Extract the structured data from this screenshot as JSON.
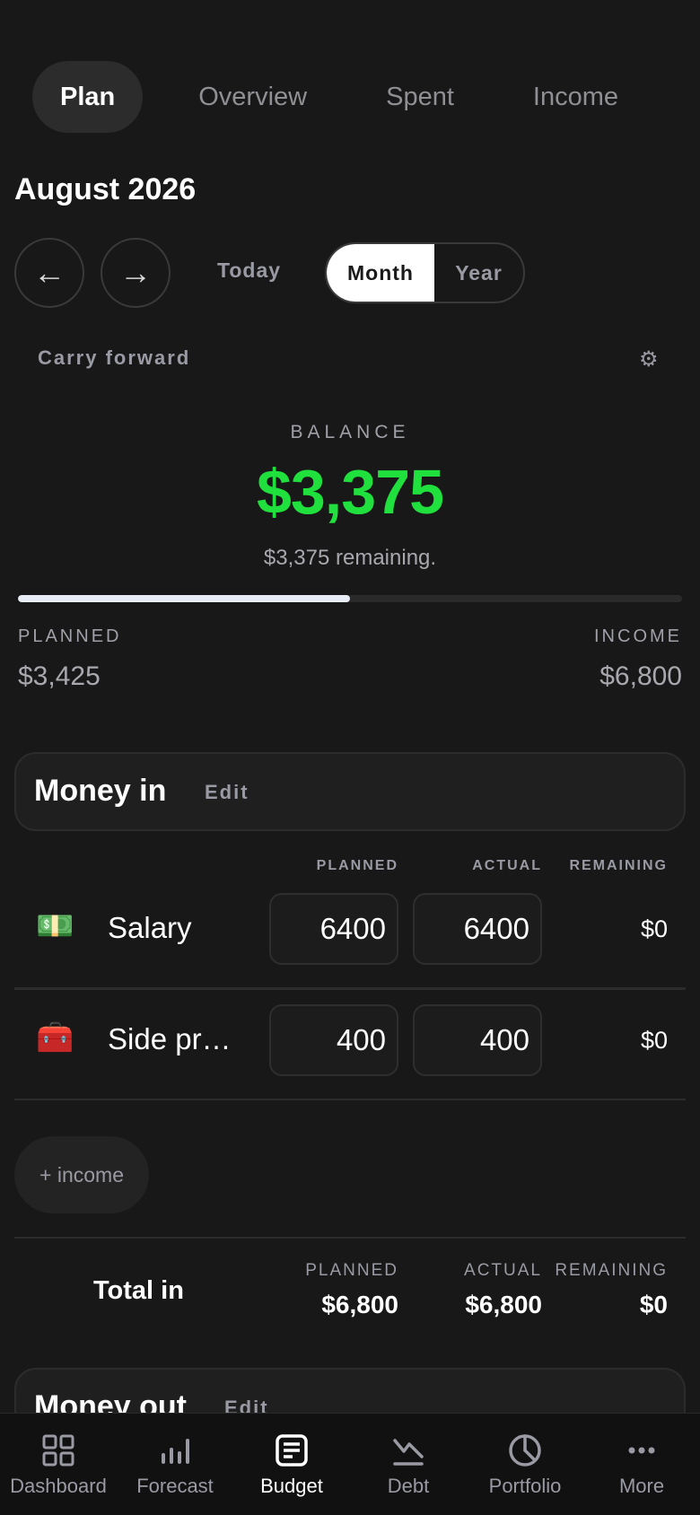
{
  "tabs": [
    "Plan",
    "Overview",
    "Spent",
    "Income"
  ],
  "period": {
    "title": "August 2026",
    "prev_icon": "←",
    "next_icon": "→",
    "today_label": "Today",
    "month_label": "Month",
    "year_label": "Year"
  },
  "carry_forward": {
    "label": "Carry forward",
    "settings_icon": "⚙"
  },
  "balance": {
    "label": "BALANCE",
    "value": "$3,375",
    "remaining_text": "$3,375 remaining.",
    "progress_fraction": 0.5,
    "planned_label": "PLANNED",
    "planned_value": "$3,425",
    "income_label": "INCOME",
    "income_value": "$6,800",
    "accent_color": "#1fe03c"
  },
  "money_in": {
    "title": "Money in",
    "edit_label": "Edit",
    "headers": {
      "planned": "PLANNED",
      "actual": "ACTUAL",
      "remaining": "REMAINING"
    },
    "rows": [
      {
        "icon": "💵",
        "icon_name": "cash-icon",
        "name": "Salary",
        "planned": "6400",
        "actual": "6400",
        "remaining": "$0"
      },
      {
        "icon": "🧰",
        "icon_name": "toolbox-icon",
        "name": "Side pr…",
        "planned": "400",
        "actual": "400",
        "remaining": "$0"
      }
    ],
    "add_label": "+ income",
    "total": {
      "label": "Total in",
      "planned_label": "PLANNED",
      "actual_label": "ACTUAL",
      "remaining_label": "REMAINING",
      "planned": "$6,800",
      "actual": "$6,800",
      "remaining": "$0"
    }
  },
  "money_out": {
    "title": "Money out",
    "edit_label": "Edit"
  },
  "bottom_nav": [
    {
      "label": "Dashboard",
      "icon": "dashboard-icon",
      "active": false
    },
    {
      "label": "Forecast",
      "icon": "bar-chart-icon",
      "active": false
    },
    {
      "label": "Budget",
      "icon": "budget-icon",
      "active": true
    },
    {
      "label": "Debt",
      "icon": "debt-icon",
      "active": false
    },
    {
      "label": "Portfolio",
      "icon": "pie-chart-icon",
      "active": false
    },
    {
      "label": "More",
      "icon": "more-icon",
      "active": false
    }
  ]
}
